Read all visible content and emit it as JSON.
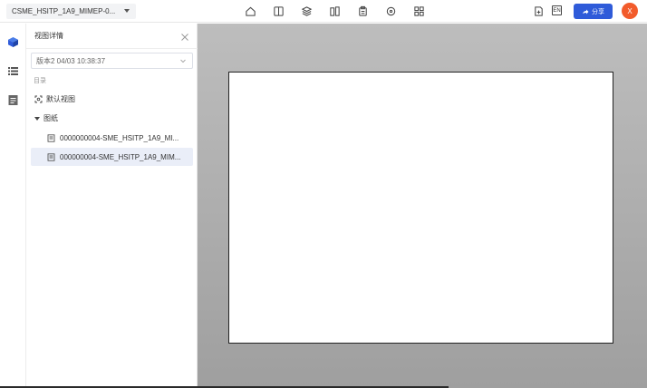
{
  "header": {
    "file_name": "CSME_HSITP_1A9_MIMEP-0...",
    "lang_label": "EN",
    "share_label": "分享",
    "avatar_initial": "X",
    "tools": [
      "home-icon",
      "split-view-icon",
      "model-icon",
      "compare-icon",
      "clipboard-icon",
      "measure-icon",
      "layers-icon"
    ],
    "accent_color": "#2f5bd9",
    "avatar_color": "#f25b2b"
  },
  "rail": {
    "icons": [
      "cube-icon",
      "list-icon",
      "document-icon"
    ]
  },
  "panel": {
    "title": "视图详情",
    "version": "版本2 04/03 10:38:37",
    "section_label": "目录",
    "default_view": "默认视图",
    "group_label": "图纸",
    "sheets": [
      {
        "label": "0000000004-SME_HSITP_1A9_MI...",
        "selected": false
      },
      {
        "label": "000000004-SME_HSITP_1A9_MIM...",
        "selected": true
      }
    ]
  }
}
